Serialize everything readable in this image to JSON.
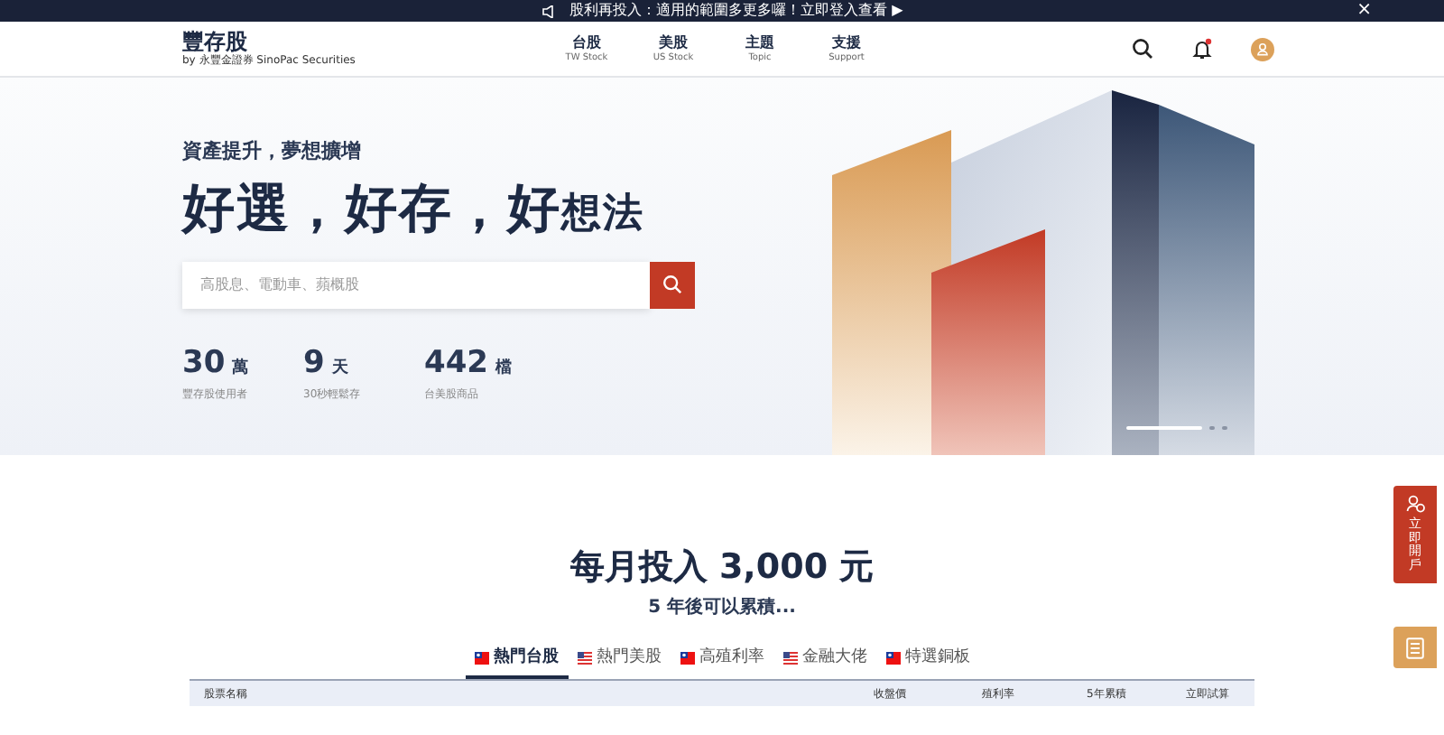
{
  "announcement": {
    "text": "股利再投入：適用的範圍多更多囉！立即登入查看 ▶",
    "close": "×"
  },
  "brand": {
    "name": "豐存股",
    "tagline": "by 永豐金證券 SinoPac Securities"
  },
  "nav": [
    {
      "label": "台股",
      "sub": "TW Stock"
    },
    {
      "label": "美股",
      "sub": "US Stock"
    },
    {
      "label": "主題",
      "sub": "Topic"
    },
    {
      "label": "支援",
      "sub": "Support"
    }
  ],
  "notifications": {
    "unread": true
  },
  "hero": {
    "subtitle": "資產提升，夢想擴增",
    "headline_main": "好選，好存，好",
    "headline_tail": "想法",
    "search": {
      "placeholder": "高股息、電動車、蘋概股"
    },
    "stats": [
      {
        "number": "30",
        "unit": "萬",
        "label": "豐存股使用者"
      },
      {
        "number": "9",
        "unit": "天",
        "label": "30秒輕鬆存"
      },
      {
        "number": "442",
        "unit": "檔",
        "label": "台美股商品"
      }
    ],
    "slides": [
      {
        "selected": true
      },
      {
        "selected": false
      },
      {
        "selected": false
      }
    ]
  },
  "calculator": {
    "title": "每月投入 3,000 元",
    "subtitle": "5 年後可以累積..."
  },
  "tabs": [
    {
      "label": "熱門台股",
      "kind": "tw",
      "selected": true
    },
    {
      "label": "熱門美股",
      "kind": "us",
      "selected": false
    },
    {
      "label": "高殖利率",
      "kind": "tw",
      "selected": false
    },
    {
      "label": "金融大佬",
      "kind": "us",
      "selected": false
    },
    {
      "label": "特選銅板",
      "kind": "tw",
      "selected": false
    }
  ],
  "table": {
    "columns": [
      "股票名稱",
      "收盤價",
      "殖利率",
      "5年累積",
      "立即試算"
    ]
  },
  "side_buttons": {
    "open_account": "立即開戶"
  }
}
